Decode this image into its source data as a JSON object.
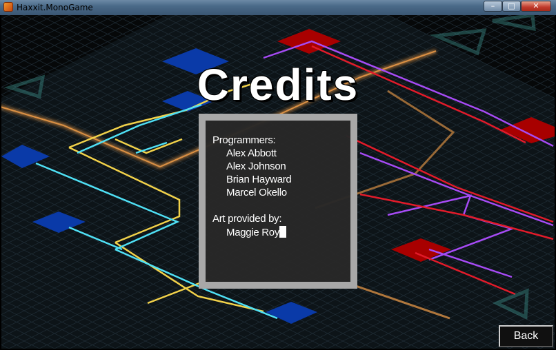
{
  "window": {
    "title": "Haxxit.MonoGame",
    "icon": "app-icon"
  },
  "window_controls": {
    "minimize": "–",
    "maximize": "□",
    "close": "✕"
  },
  "screen": {
    "heading": "Credits",
    "credits": {
      "programmers_label": "Programmers:",
      "programmers": [
        "Alex Abbott",
        "Alex Johnson",
        "Brian Hayward",
        "Marcel Okello"
      ],
      "art_label": "Art provided by:",
      "artists": [
        "Maggie Roy"
      ]
    },
    "back_label": "Back"
  },
  "colors": {
    "node_blue": "#0a3aa8",
    "node_red": "#a80000",
    "line_yellow": "#f2d24a",
    "line_cyan": "#4fe0f5",
    "line_purple": "#a64bf5",
    "line_red": "#e21b2a",
    "line_orange": "#f5a04a",
    "panel_border": "#a8a8a8"
  }
}
